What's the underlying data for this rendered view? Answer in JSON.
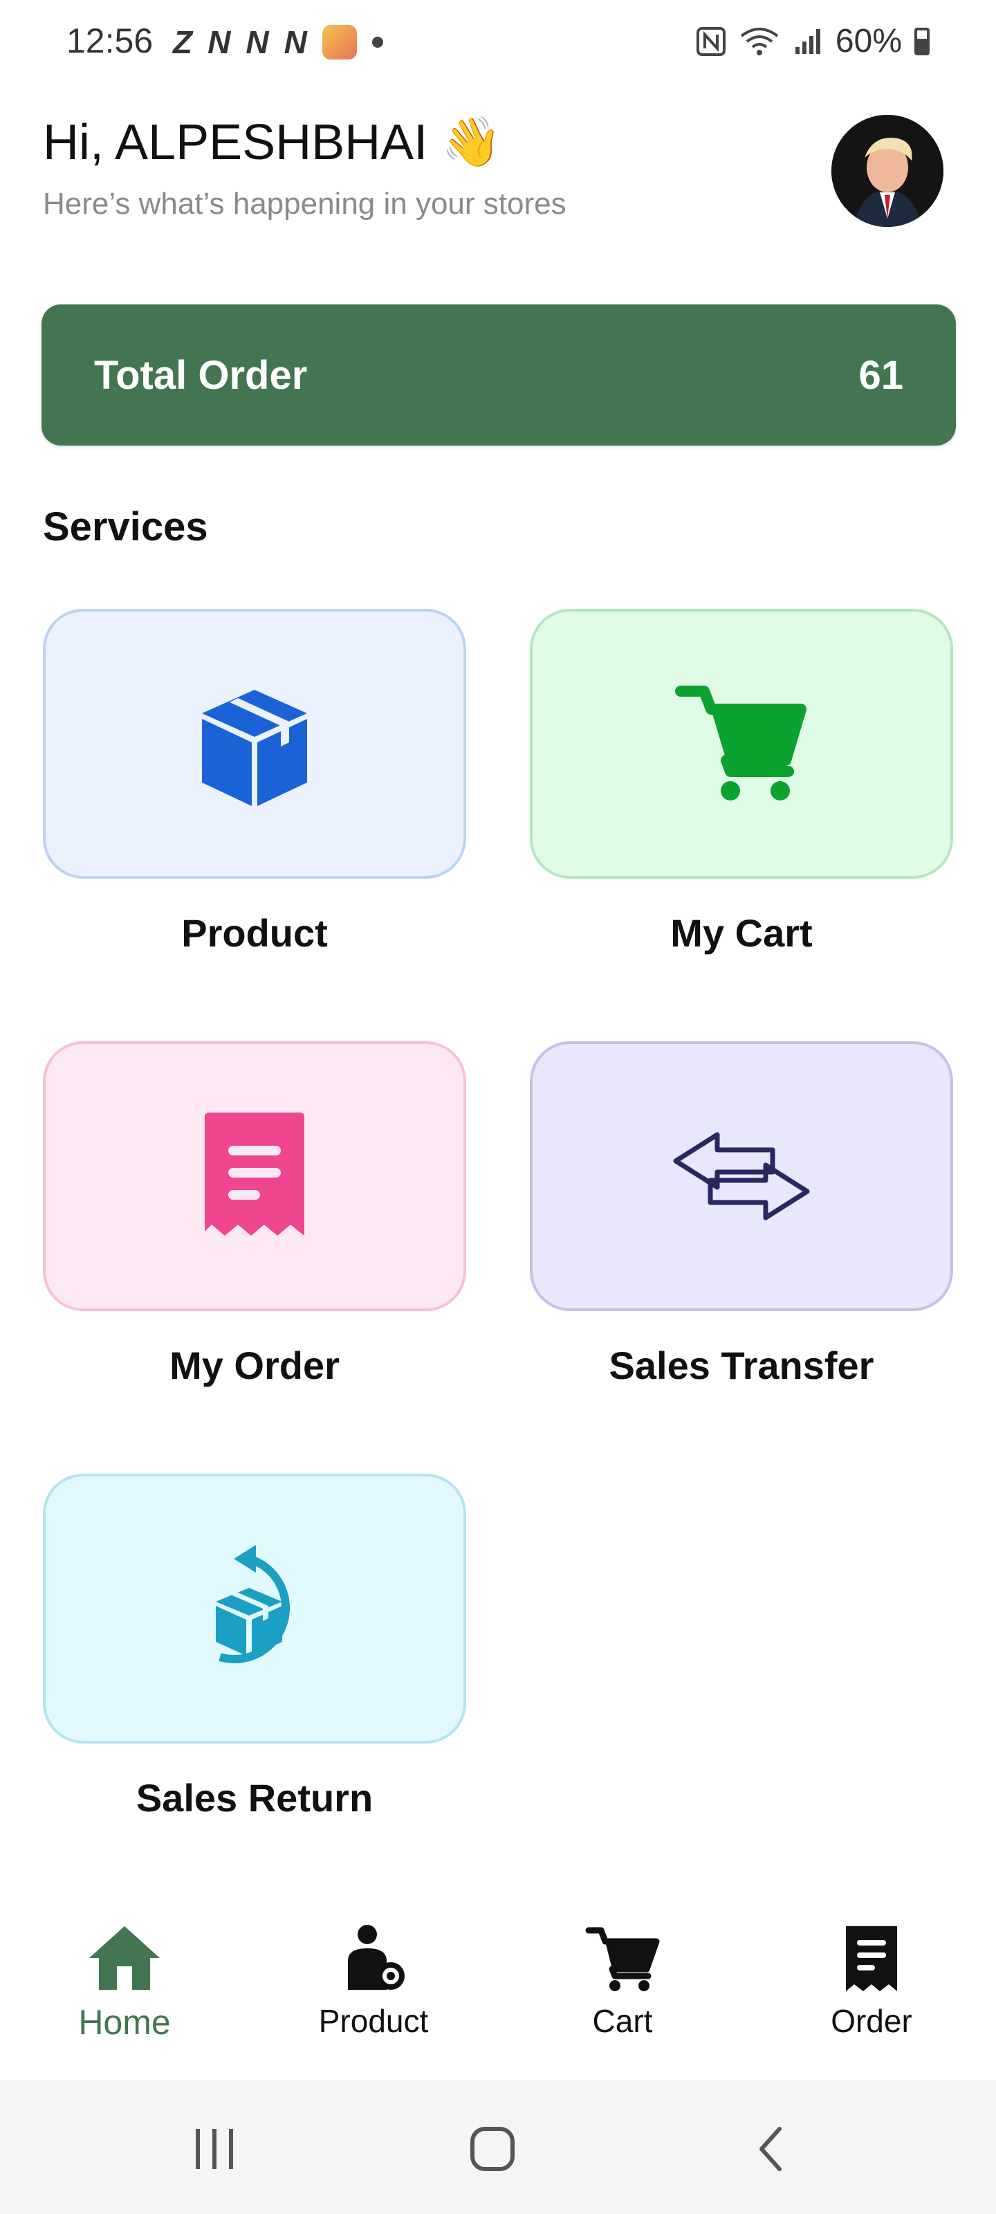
{
  "status_bar": {
    "time": "12:56",
    "notification_icons": [
      "Z",
      "N",
      "N",
      "N"
    ],
    "battery": "60%"
  },
  "header": {
    "greeting": "Hi, ALPESHBHAI",
    "subtitle": "Here’s what’s happening in your stores"
  },
  "total_order": {
    "label": "Total Order",
    "value": "61"
  },
  "services": {
    "title": "Services",
    "items": [
      {
        "label": "Product",
        "icon": "box-icon",
        "bg": "#ebf2fe",
        "color": "#1a63d6"
      },
      {
        "label": "My Cart",
        "icon": "cart-icon",
        "bg": "#e1fce6",
        "color": "#0ca22f"
      },
      {
        "label": "My Order",
        "icon": "receipt-icon",
        "bg": "#fde9f4",
        "color": "#f0458f"
      },
      {
        "label": "Sales Transfer",
        "icon": "transfer-arrows-icon",
        "bg": "#e8e7fc",
        "color": "#2a2860"
      },
      {
        "label": "Sales Return",
        "icon": "return-box-icon",
        "bg": "#e1f9fd",
        "color": "#1ba0c4"
      }
    ]
  },
  "bottom_nav": {
    "items": [
      {
        "label": "Home",
        "icon": "home-icon",
        "active": true
      },
      {
        "label": "Product",
        "icon": "product-person-icon",
        "active": false
      },
      {
        "label": "Cart",
        "icon": "cart-icon",
        "active": false
      },
      {
        "label": "Order",
        "icon": "receipt-icon",
        "active": false
      }
    ]
  },
  "colors": {
    "accent": "#427550"
  }
}
